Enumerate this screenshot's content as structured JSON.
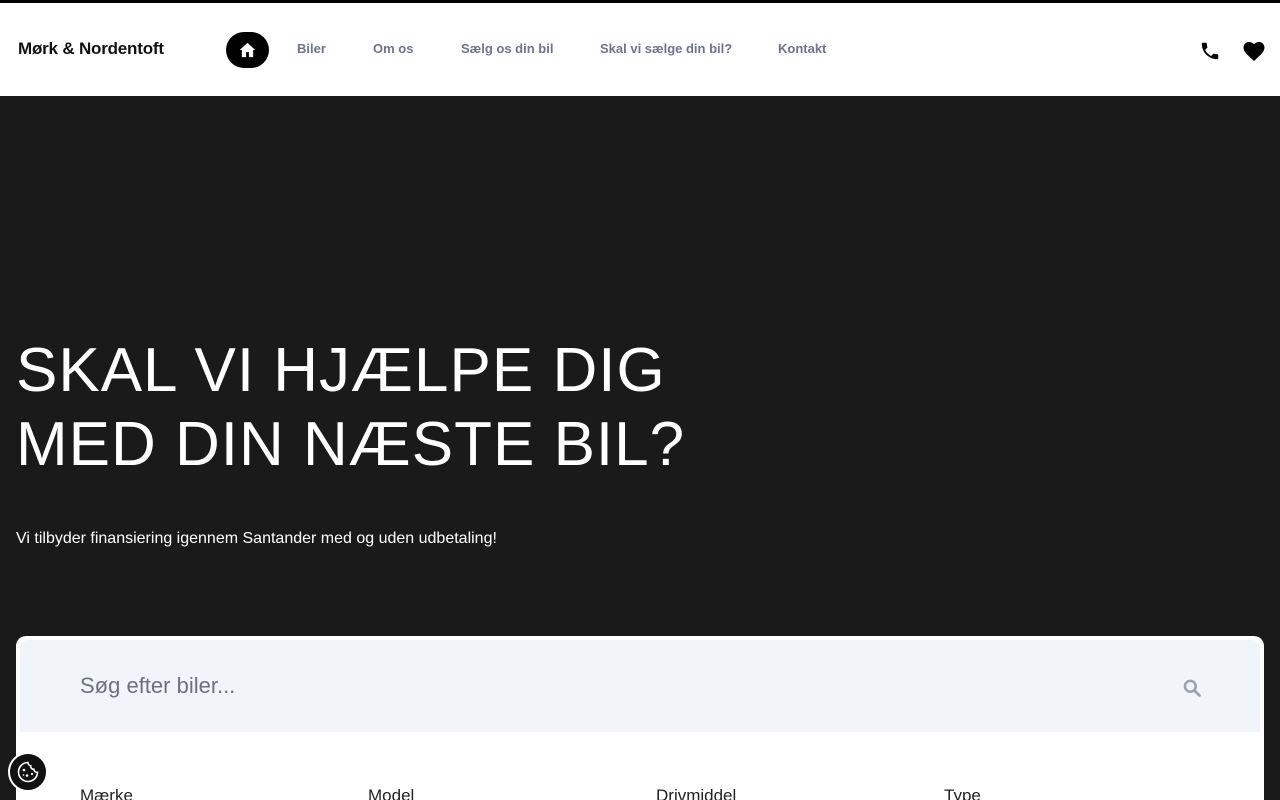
{
  "header": {
    "logo": "Mørk & Nordentoft",
    "nav": [
      {
        "label": "Biler"
      },
      {
        "label": "Om os"
      },
      {
        "label": "Sælg os din bil"
      },
      {
        "label": "Skal vi sælge din bil?"
      },
      {
        "label": "Kontakt"
      }
    ],
    "icons": {
      "home": "home-icon",
      "phone": "phone-icon",
      "favorites": "heart-icon"
    }
  },
  "hero": {
    "title_line1": "SKAL VI HJÆLPE DIG",
    "title_line2": "MED DIN NÆSTE BIL?",
    "subtitle": "Vi tilbyder finansiering igennem Santander med og uden udbetaling!"
  },
  "search": {
    "placeholder": "Søg efter biler...",
    "value": "",
    "filters": [
      "Mærke",
      "Model",
      "Drivmiddel",
      "Type"
    ]
  },
  "colors": {
    "hero_bg": "#1a1a1a",
    "nav_text": "#6b7590",
    "search_bg": "#f1f4f9"
  }
}
